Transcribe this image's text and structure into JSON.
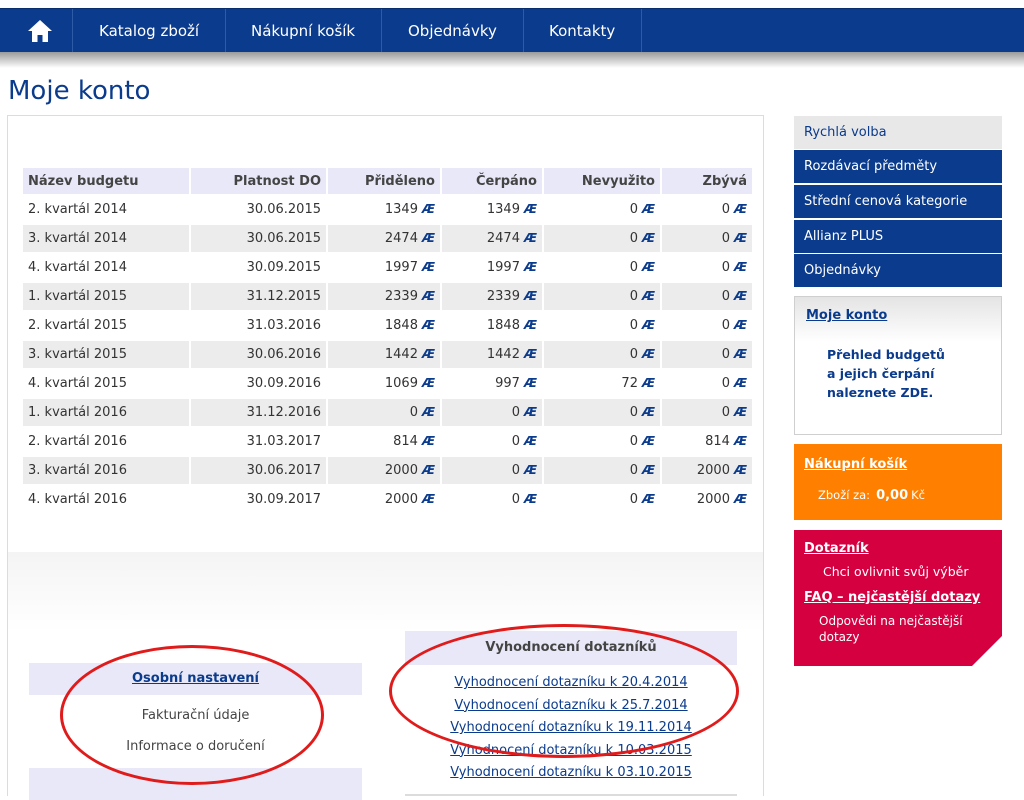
{
  "nav": {
    "items": [
      "Katalog zboží",
      "Nákupní košík",
      "Objednávky",
      "Kontakty"
    ]
  },
  "page_title": "Moje konto",
  "currency_symbol": "Æ",
  "table": {
    "headers": [
      "Název budgetu",
      "Platnost DO",
      "Přiděleno",
      "Čerpáno",
      "Nevyužito",
      "Zbývá"
    ],
    "rows": [
      [
        "2. kvartál 2014",
        "30.06.2015",
        "1349",
        "1349",
        "0",
        "0"
      ],
      [
        "3. kvartál 2014",
        "30.06.2015",
        "2474",
        "2474",
        "0",
        "0"
      ],
      [
        "4. kvartál 2014",
        "30.09.2015",
        "1997",
        "1997",
        "0",
        "0"
      ],
      [
        "1. kvartál 2015",
        "31.12.2015",
        "2339",
        "2339",
        "0",
        "0"
      ],
      [
        "2. kvartál 2015",
        "31.03.2016",
        "1848",
        "1848",
        "0",
        "0"
      ],
      [
        "3. kvartál 2015",
        "30.06.2016",
        "1442",
        "1442",
        "0",
        "0"
      ],
      [
        "4. kvartál 2015",
        "30.09.2016",
        "1069",
        "997",
        "72",
        "0"
      ],
      [
        "1. kvartál 2016",
        "31.12.2016",
        "0",
        "0",
        "0",
        "0"
      ],
      [
        "2. kvartál 2016",
        "31.03.2017",
        "814",
        "0",
        "0",
        "814"
      ],
      [
        "3. kvartál 2016",
        "30.06.2017",
        "2000",
        "0",
        "0",
        "2000"
      ],
      [
        "4. kvartál 2016",
        "30.09.2017",
        "2000",
        "0",
        "0",
        "2000"
      ]
    ]
  },
  "settings": {
    "title": "Osobní nastavení",
    "items": [
      "Fakturační údaje",
      "Informace o doručení"
    ]
  },
  "surveys": {
    "title": "Vyhodnocení dotazníků",
    "links": [
      "Vyhodnocení dotazníku k 20.4.2014",
      "Vyhodnocení dotazníku k 25.7.2014",
      "Vyhodnocení dotazníku k 19.11.2014",
      "Vyhodnocení dotazníku k 10.03.2015",
      "Vyhodnocení dotazníku k 03.10.2015"
    ]
  },
  "sidebar": {
    "quick_title": "Rychlá volba",
    "quick_items": [
      "Rozdávací předměty",
      "Střední cenová kategorie",
      "Allianz PLUS",
      "Objednávky"
    ],
    "account": {
      "title": "Moje konto",
      "text": [
        "Přehled budgetů",
        "a jejich čerpání",
        "naleznete ZDE."
      ]
    },
    "cart": {
      "title": "Nákupní košík",
      "label": "Zboží za:",
      "amount": "0,00",
      "currency": "Kč"
    },
    "survey": {
      "title": "Dotazník",
      "text": "Chci ovlivnit svůj výběr",
      "faq_title": "FAQ – nejčastější dotazy",
      "faq_text": "Odpovědi na nejčastější dotazy"
    }
  },
  "colors": {
    "nav_blue": "#0b3b8c",
    "cart_orange": "#ff8000",
    "survey_red": "#d40040",
    "annotation_red": "#e01b1b"
  }
}
